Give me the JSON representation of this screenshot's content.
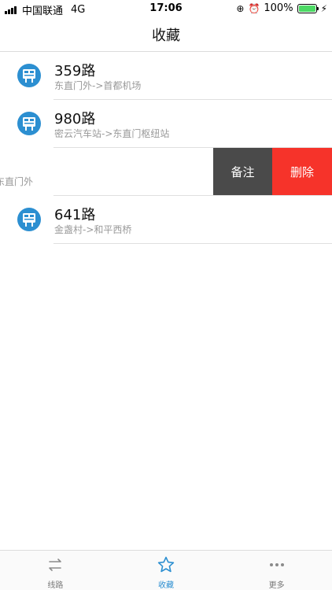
{
  "status_bar": {
    "carrier": "中国联通",
    "network": "4G",
    "time": "17:06",
    "battery_percent": "100%",
    "battery_level": 1.0
  },
  "nav": {
    "title": "收藏"
  },
  "favorites": [
    {
      "name": "359路",
      "route": "东直门外->首都机场"
    },
    {
      "name": "980路",
      "route": "密云汽车站->东直门枢纽站"
    },
    {
      "name": "",
      "route": "东直门外",
      "swiped": true
    },
    {
      "name": "641路",
      "route": "金盏村->和平西桥"
    }
  ],
  "swipe_actions": {
    "note_label": "备注",
    "delete_label": "删除"
  },
  "tabs": [
    {
      "label": "线路",
      "icon": "switch-arrows-icon",
      "active": false
    },
    {
      "label": "收藏",
      "icon": "star-icon",
      "active": true
    },
    {
      "label": "更多",
      "icon": "more-dots-icon",
      "active": false
    }
  ],
  "colors": {
    "accent": "#2c8fd1",
    "delete": "#f6332a",
    "note": "#4a4a4a",
    "battery": "#4cd964"
  }
}
